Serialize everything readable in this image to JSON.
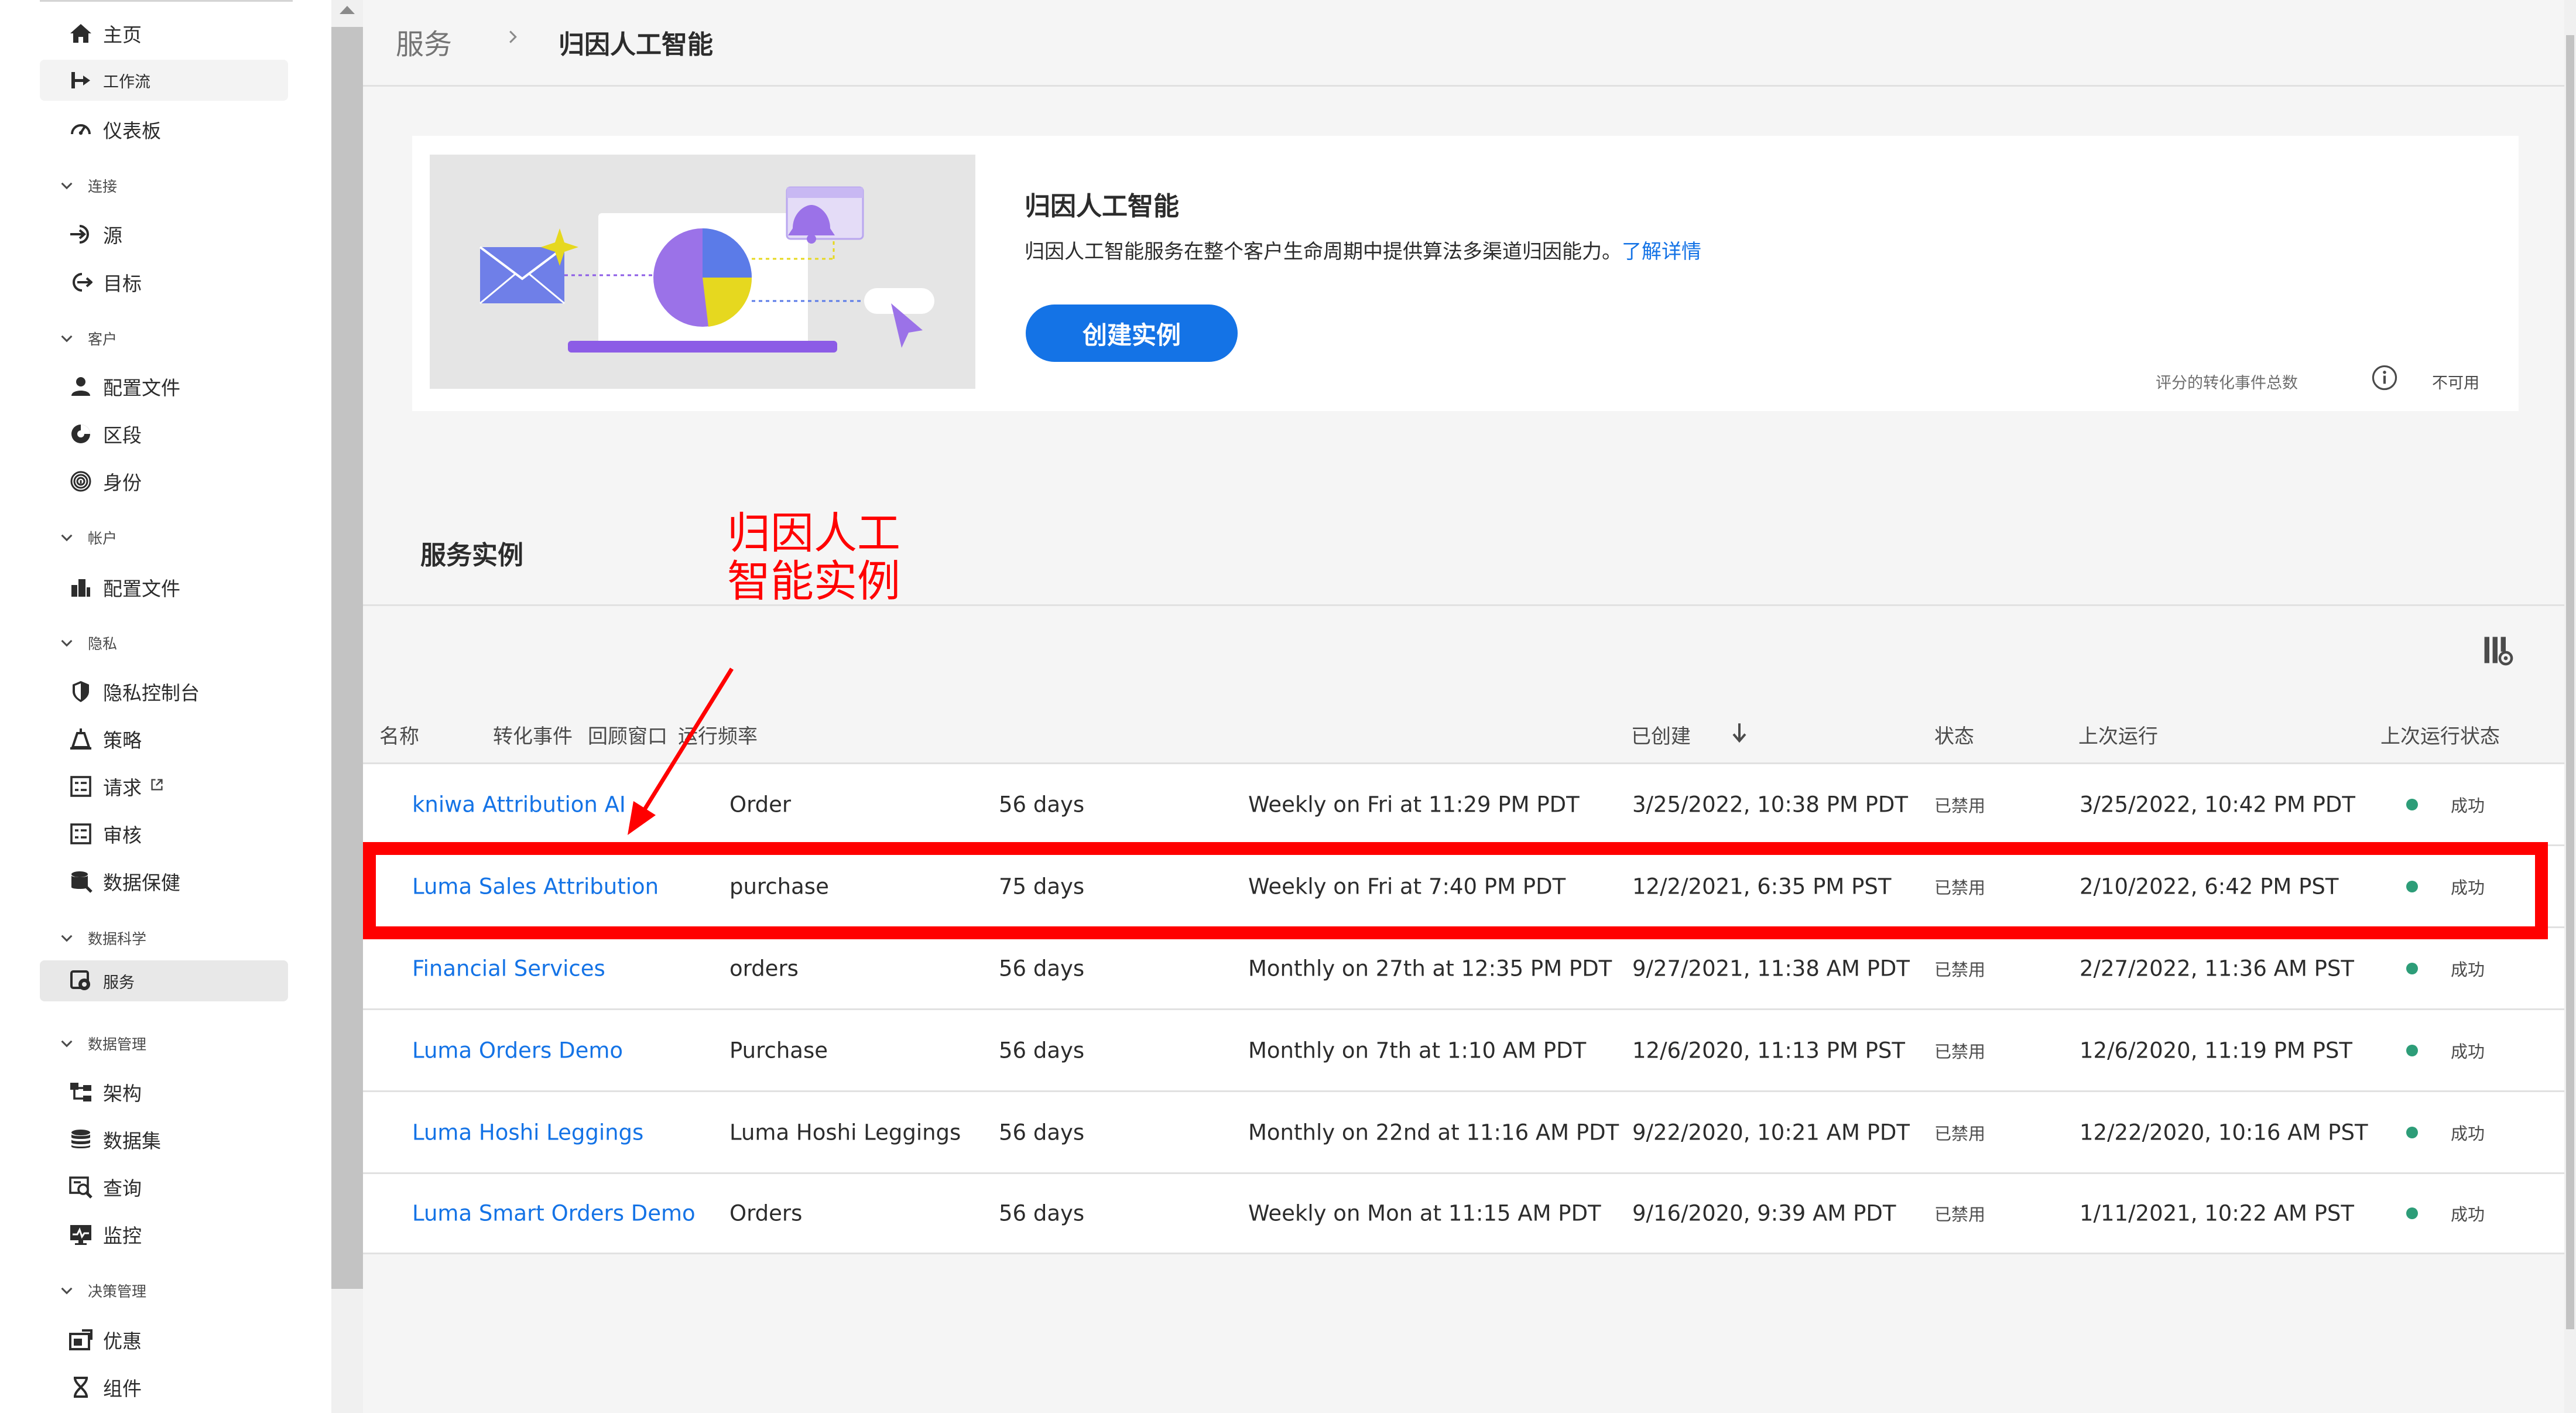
{
  "sidebar": {
    "items": [
      {
        "label": "主页",
        "icon": "home-icon"
      },
      {
        "label": "工作流",
        "icon": "workflow-icon"
      },
      {
        "label": "仪表板",
        "icon": "dashboard-icon"
      },
      {
        "label": "源",
        "icon": "sources-icon"
      },
      {
        "label": "目标",
        "icon": "destinations-icon"
      },
      {
        "label": "配置文件",
        "icon": "profile-icon"
      },
      {
        "label": "区段",
        "icon": "segments-icon"
      },
      {
        "label": "身份",
        "icon": "fingerprint-icon"
      },
      {
        "label": "配置文件",
        "icon": "account-profile-icon"
      },
      {
        "label": "隐私控制台",
        "icon": "shield-icon"
      },
      {
        "label": "策略",
        "icon": "policies-icon"
      },
      {
        "label": "请求",
        "icon": "requests-icon"
      },
      {
        "label": "审核",
        "icon": "audits-icon"
      },
      {
        "label": "数据保健",
        "icon": "data-hygiene-icon"
      },
      {
        "label": "服务",
        "icon": "services-icon"
      },
      {
        "label": "架构",
        "icon": "schemas-icon"
      },
      {
        "label": "数据集",
        "icon": "datasets-icon"
      },
      {
        "label": "查询",
        "icon": "queries-icon"
      },
      {
        "label": "监控",
        "icon": "monitoring-icon"
      },
      {
        "label": "优惠",
        "icon": "offers-icon"
      },
      {
        "label": "组件",
        "icon": "components-icon"
      }
    ],
    "sections": {
      "connections": "连接",
      "customer": "客户",
      "account": "帐户",
      "privacy": "隐私",
      "data_science": "数据科学",
      "data_management": "数据管理",
      "decisioning": "决策管理"
    }
  },
  "header": {
    "breadcrumb_root": "服务",
    "breadcrumb_current": "归因人工智能"
  },
  "hero": {
    "title": "归因人工智能",
    "description": "归因人工智能服务在整个客户生命周期中提供算法多渠道归因能力。",
    "learn_more": "了解详情",
    "create_button": "创建实例",
    "metric_label": "评分的转化事件总数",
    "metric_value": "不可用"
  },
  "instances": {
    "title": "服务实例",
    "columns": [
      "名称",
      "转化事件",
      "回顾窗口",
      "运行频率",
      "已创建",
      "状态",
      "上次运行",
      "上次运行状态"
    ],
    "rows": [
      {
        "name": "kniwa Attribution AI",
        "event": "Order",
        "lookback": "56 days",
        "frequency": "Weekly on Fri at 11:29 PM PDT",
        "created": "3/25/2022, 10:38 PM PDT",
        "status": "已禁用",
        "last_run": "3/25/2022, 10:42 PM PDT",
        "last_status": "成功"
      },
      {
        "name": "Luma Sales Attribution",
        "event": "purchase",
        "lookback": "75 days",
        "frequency": "Weekly on Fri at 7:40 PM PDT",
        "created": "12/2/2021, 6:35 PM PST",
        "status": "已禁用",
        "last_run": "2/10/2022, 6:42 PM PST",
        "last_status": "成功"
      },
      {
        "name": "Financial Services",
        "event": "orders",
        "lookback": "56 days",
        "frequency": "Monthly on 27th at 12:35 PM PDT",
        "created": "9/27/2021, 11:38 AM PDT",
        "status": "已禁用",
        "last_run": "2/27/2022, 11:36 AM PST",
        "last_status": "成功"
      },
      {
        "name": "Luma Orders Demo",
        "event": "Purchase",
        "lookback": "56 days",
        "frequency": "Monthly on 7th at 1:10 AM PDT",
        "created": "12/6/2020, 11:13 PM PST",
        "status": "已禁用",
        "last_run": "12/6/2020, 11:19 PM PST",
        "last_status": "成功"
      },
      {
        "name": "Luma Hoshi Leggings",
        "event": "Luma Hoshi Leggings",
        "lookback": "56 days",
        "frequency": "Monthly on 22nd at 11:16 AM PDT",
        "created": "9/22/2020, 10:21 AM PDT",
        "status": "已禁用",
        "last_run": "12/22/2020, 10:16 AM PST",
        "last_status": "成功"
      },
      {
        "name": "Luma Smart Orders Demo",
        "event": "Orders",
        "lookback": "56 days",
        "frequency": "Weekly on Mon at 11:15 AM PDT",
        "created": "9/16/2020, 9:39 AM PDT",
        "status": "已禁用",
        "last_run": "1/11/2021, 10:22 AM PST",
        "last_status": "成功"
      }
    ]
  },
  "annotation": {
    "text": "归因人工\n智能实例"
  },
  "colors": {
    "accent": "#1473e6",
    "success": "#2d9d78",
    "annotation": "#ff0000"
  }
}
